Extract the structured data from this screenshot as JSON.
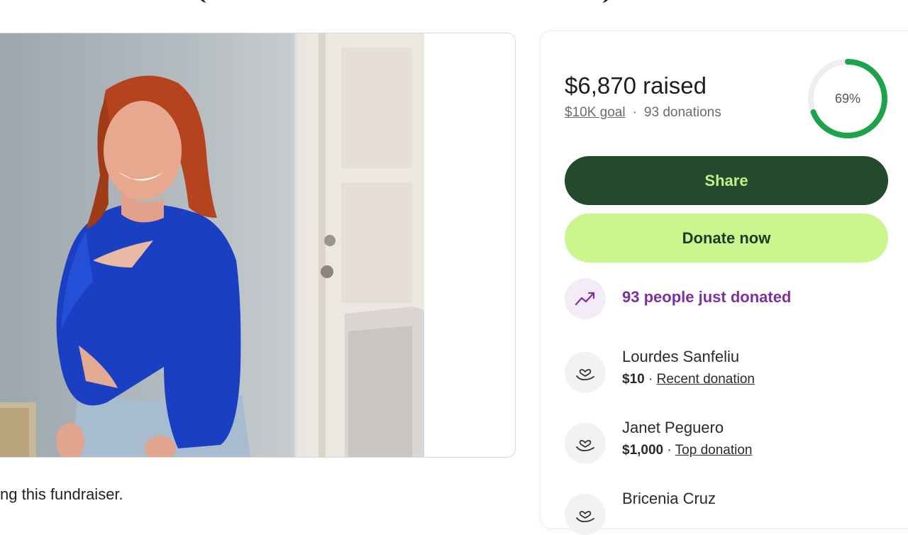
{
  "progress": {
    "raised_label": "$6,870 raised",
    "goal_label": "$10K goal",
    "separator": "·",
    "donations_label": "93 donations",
    "percent_label": "69%",
    "percent_value": 0.69,
    "ring_color": "#1fa34a",
    "ring_track_color": "#eeeeee"
  },
  "actions": {
    "share_label": "Share",
    "donate_label": "Donate now"
  },
  "activity": {
    "trend_label": "93 people just donated",
    "icon": "trending-up-icon"
  },
  "donors": [
    {
      "name": "Lourdes Sanfeliu",
      "amount": "$10",
      "sep": " · ",
      "tag": "Recent donation",
      "icon": "hand-heart-icon"
    },
    {
      "name": "Janet Peguero",
      "amount": "$1,000",
      "sep": " · ",
      "tag": "Top donation",
      "icon": "hand-heart-icon"
    },
    {
      "name": "Bricenia Cruz",
      "amount": "",
      "sep": "",
      "tag": "",
      "icon": "hand-heart-icon"
    }
  ],
  "story": {
    "caption": "ng this fundraiser."
  },
  "colors": {
    "share_bg": "#244a2e",
    "share_text": "#c4f08c",
    "donate_bg": "#ccf48f",
    "donate_text": "#1e3a24",
    "trend_text": "#7b2fa0"
  }
}
